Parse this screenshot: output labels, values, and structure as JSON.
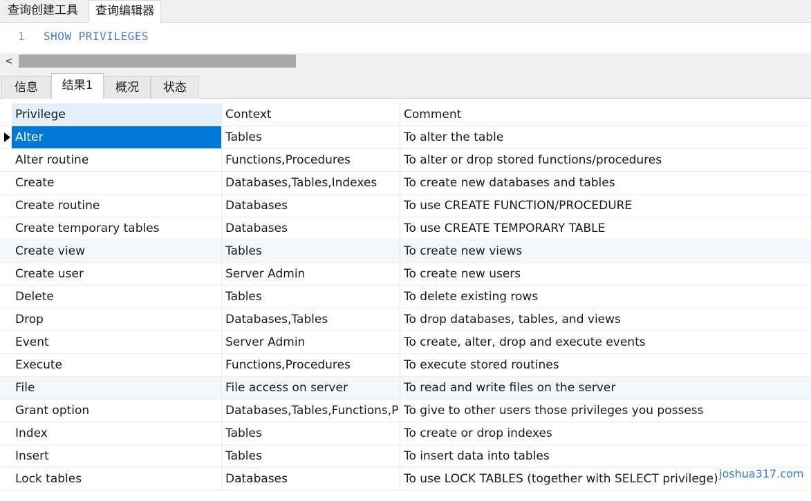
{
  "top_tabs": [
    {
      "label": "查询创建工具",
      "active": false
    },
    {
      "label": "查询编辑器",
      "active": true
    }
  ],
  "editor": {
    "line_number": "1",
    "code": "SHOW PRIVILEGES"
  },
  "scrollbar": {
    "left_arrow": "<"
  },
  "result_tabs": [
    {
      "label": "信息",
      "active": false
    },
    {
      "label": "结果1",
      "active": true
    },
    {
      "label": "概况",
      "active": false
    },
    {
      "label": "状态",
      "active": false
    }
  ],
  "table": {
    "columns": [
      "Privilege",
      "Context",
      "Comment"
    ],
    "rows": [
      [
        "Alter",
        "Tables",
        "To alter the table"
      ],
      [
        "Alter routine",
        "Functions,Procedures",
        "To alter or drop stored functions/procedures"
      ],
      [
        "Create",
        "Databases,Tables,Indexes",
        "To create new databases and tables"
      ],
      [
        "Create routine",
        "Databases",
        "To use CREATE FUNCTION/PROCEDURE"
      ],
      [
        "Create temporary tables",
        "Databases",
        "To use CREATE TEMPORARY TABLE"
      ],
      [
        "Create view",
        "Tables",
        "To create new views"
      ],
      [
        "Create user",
        "Server Admin",
        "To create new users"
      ],
      [
        "Delete",
        "Tables",
        "To delete existing rows"
      ],
      [
        "Drop",
        "Databases,Tables",
        "To drop databases, tables, and views"
      ],
      [
        "Event",
        "Server Admin",
        "To create, alter, drop and execute events"
      ],
      [
        "Execute",
        "Functions,Procedures",
        "To execute stored routines"
      ],
      [
        "File",
        "File access on server",
        "To read and write files on the server"
      ],
      [
        "Grant option",
        "Databases,Tables,Functions,P",
        "To give to other users those privileges you possess"
      ],
      [
        "Index",
        "Tables",
        "To create or drop indexes"
      ],
      [
        "Insert",
        "Tables",
        "To insert data into tables"
      ],
      [
        "Lock tables",
        "Databases",
        "To use LOCK TABLES (together with SELECT privilege)"
      ]
    ],
    "selected_row": 0
  },
  "watermark": "joshua317.com",
  "colors": {
    "selection": "#0078d7",
    "keyword": "#4a7bd8",
    "header_selected": "#e2eefb",
    "watermark": "#3a7bd5"
  }
}
